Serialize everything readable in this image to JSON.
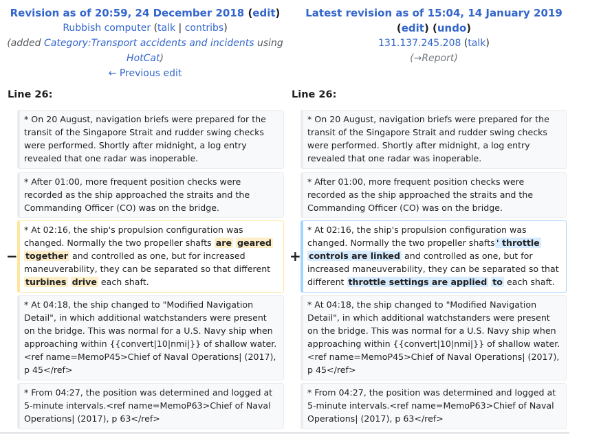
{
  "left_header": {
    "title": "Revision as of 20:59, 24 December 2018",
    "edit_label": "edit",
    "user": "Rubbish computer",
    "talk": "talk",
    "contribs": "contribs",
    "summary_added": "(added ",
    "summary_category": "Category:Transport accidents and incidents",
    "summary_using": " using ",
    "summary_hotcat": "HotCat",
    "summary_close": ")",
    "prev_edit": "← Previous edit"
  },
  "right_header": {
    "title": "Latest revision as of 15:04, 14 January 2019",
    "edit_label": "edit",
    "undo_label": "undo",
    "user": "131.137.245.208",
    "talk": "talk",
    "summary": "(→Report)"
  },
  "line_label": "Line 26:",
  "markers": {
    "minus": "−",
    "plus": "+"
  },
  "rows": [
    {
      "left": "* On 20 August, navigation briefs were prepared for the transit of the Singapore Strait and rudder swing checks were performed. Shortly after midnight, a log entry revealed that one radar was inoperable.",
      "right": "* On 20 August, navigation briefs were prepared for the transit of the Singapore Strait and rudder swing checks were performed. Shortly after midnight, a log entry revealed that one radar was inoperable."
    },
    {
      "left": "* After 01:00, more frequent position checks were recorded as the ship approached the straits and the Commanding Officer (CO) was on the bridge.",
      "right": "* After 01:00, more frequent position checks were recorded as the ship approached the straits and the Commanding Officer (CO) was on the bridge."
    },
    {
      "left_parts": [
        "* At 02:16, the ship's propulsion configuration was changed. Normally the two propeller shafts ",
        "are",
        " ",
        "geared",
        " ",
        "together",
        " and controlled as one, but for increased maneuverability, they can be separated so that different ",
        "turbines",
        " ",
        "drive",
        " each shaft."
      ],
      "right_parts": [
        "* At 02:16, the ship's propulsion configuration was changed. Normally the two propeller shafts",
        "' throttle",
        " ",
        "controls are linked",
        " and controlled as one, but for increased maneuverability, they can be separated so that different ",
        "throttle settings are applied",
        " ",
        "to",
        " each shaft."
      ]
    },
    {
      "left": "* At 04:18, the ship changed to \"Modified Navigation Detail\", in which additional watchstanders were present on the bridge. This was normal for a U.S. Navy ship when approaching within {{convert|10|nmi|}} of shallow water.<ref name=MemoP45>Chief of Naval Operations| (2017), p 45</ref>",
      "right": "* At 04:18, the ship changed to \"Modified Navigation Detail\", in which additional watchstanders were present on the bridge. This was normal for a U.S. Navy ship when approaching within {{convert|10|nmi|}} of shallow water.<ref name=MemoP45>Chief of Naval Operations| (2017), p 45</ref>"
    },
    {
      "left": "* From 04:27, the position was determined and logged at 5-minute intervals.<ref name=MemoP63>Chief of Naval Operations| (2017), p 63</ref>",
      "right": "* From 04:27, the position was determined and logged at 5-minute intervals.<ref name=MemoP63>Chief of Naval Operations| (2017), p 63</ref>"
    }
  ]
}
